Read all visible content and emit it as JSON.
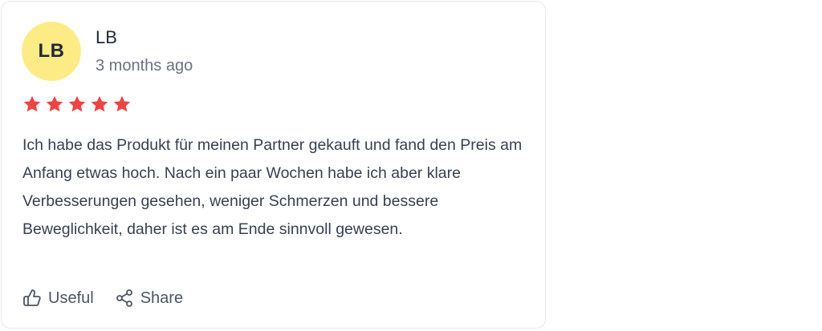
{
  "review": {
    "avatar_initials": "LB",
    "avatar_color": "#fdec85",
    "author": "LB",
    "time": "3 months ago",
    "rating": 5,
    "rating_max": 5,
    "star_color": "#ef4444",
    "text": "Ich habe das Produkt für meinen Partner gekauft und fand den Preis am Anfang etwas hoch. Nach ein paar Wochen habe ich aber klare Verbesserungen gesehen, weniger Schmerzen und bessere Beweglichkeit, daher ist es am Ende sinnvoll gewesen.",
    "actions": {
      "useful_label": "Useful",
      "useful_icon": "thumbs-up-icon",
      "share_label": "Share",
      "share_icon": "share-icon"
    }
  }
}
